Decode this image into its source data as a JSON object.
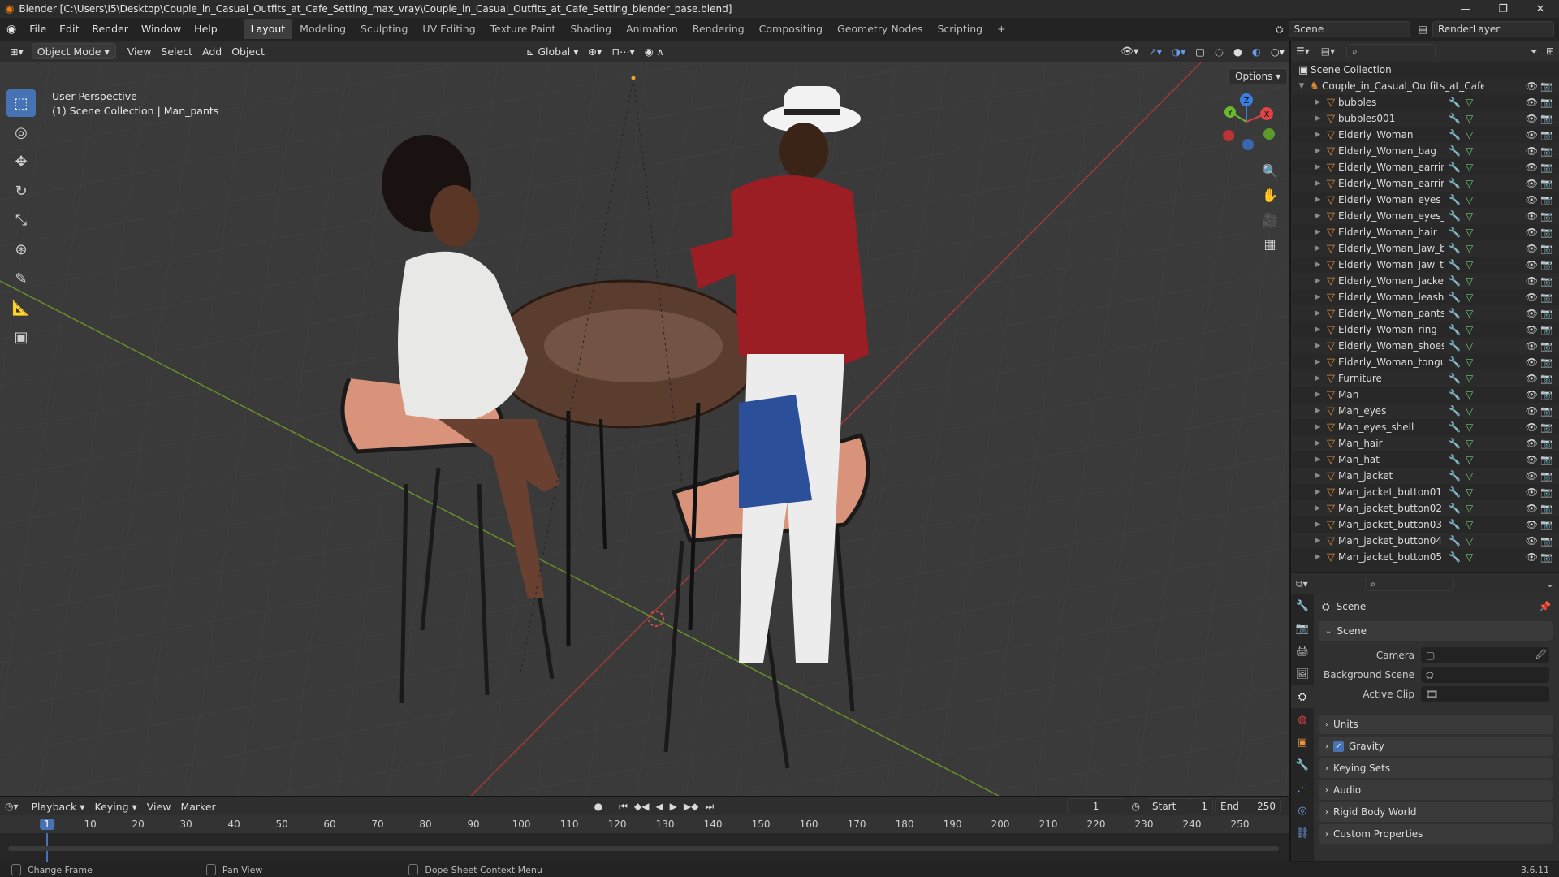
{
  "window": {
    "title": "Blender [C:\\Users\\I5\\Desktop\\Couple_in_Casual_Outfits_at_Cafe_Setting_max_vray\\Couple_in_Casual_Outfits_at_Cafe_Setting_blender_base.blend]",
    "minimize": "—",
    "maximize": "❐",
    "close": "✕"
  },
  "menus": [
    "File",
    "Edit",
    "Render",
    "Window",
    "Help"
  ],
  "workspaces": [
    "Layout",
    "Modeling",
    "Sculpting",
    "UV Editing",
    "Texture Paint",
    "Shading",
    "Animation",
    "Rendering",
    "Compositing",
    "Geometry Nodes",
    "Scripting",
    "+"
  ],
  "scene_field": "Scene",
  "renderlayer_field": "RenderLayer",
  "viewport_header": {
    "mode": "Object Mode",
    "menus": [
      "View",
      "Select",
      "Add",
      "Object"
    ],
    "transform": "Global",
    "options": "Options"
  },
  "viewport_info": {
    "line1": "User Perspective",
    "line2": "(1) Scene Collection | Man_pants"
  },
  "gizmo": {
    "z": "Z",
    "y": "Y",
    "x": "X"
  },
  "outliner": {
    "root": "Scene Collection",
    "collection": "Couple_in_Casual_Outfits_at_Cafe_Settir",
    "items": [
      "bubbles",
      "bubbles001",
      "Elderly_Woman",
      "Elderly_Woman_bag",
      "Elderly_Woman_earring_L",
      "Elderly_Woman_earring_R",
      "Elderly_Woman_eyes",
      "Elderly_Woman_eyes_shell",
      "Elderly_Woman_hair",
      "Elderly_Woman_Jaw_bottom",
      "Elderly_Woman_Jaw_top",
      "Elderly_Woman_Jacket",
      "Elderly_Woman_leash",
      "Elderly_Woman_pants",
      "Elderly_Woman_ring",
      "Elderly_Woman_shoes",
      "Elderly_Woman_tongue",
      "Furniture",
      "Man",
      "Man_eyes",
      "Man_eyes_shell",
      "Man_hair",
      "Man_hat",
      "Man_jacket",
      "Man_jacket_button01",
      "Man_jacket_button02",
      "Man_jacket_button03",
      "Man_jacket_button04",
      "Man_jacket_button05"
    ]
  },
  "properties": {
    "context": "Scene",
    "panel_scene": "Scene",
    "camera_label": "Camera",
    "background_label": "Background Scene",
    "clip_label": "Active Clip",
    "panels": [
      "Units",
      "Gravity",
      "Keying Sets",
      "Audio",
      "Rigid Body World",
      "Custom Properties"
    ],
    "version": "3.6.11"
  },
  "timeline": {
    "menus": [
      "Playback",
      "Keying",
      "View",
      "Marker"
    ],
    "current_frame": "1",
    "start_label": "Start",
    "start": "1",
    "end_label": "End",
    "end": "250",
    "ticks": [
      "1",
      "10",
      "20",
      "30",
      "40",
      "50",
      "60",
      "70",
      "80",
      "90",
      "100",
      "110",
      "120",
      "130",
      "140",
      "150",
      "160",
      "170",
      "180",
      "190",
      "200",
      "210",
      "220",
      "230",
      "240",
      "250"
    ]
  },
  "statusbar": {
    "left": "Change Frame",
    "mid": "Pan View",
    "right": "Dope Sheet Context Menu"
  }
}
